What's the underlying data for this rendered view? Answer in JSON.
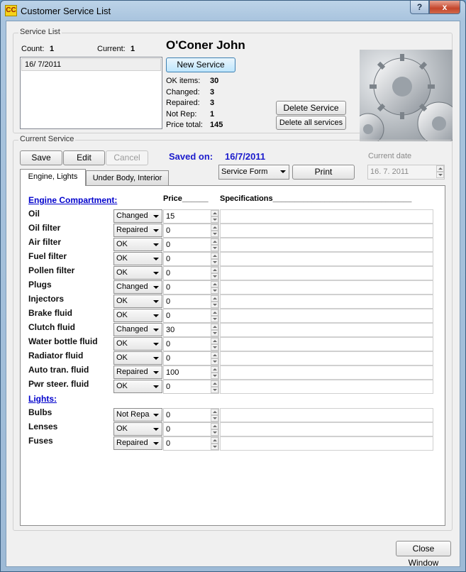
{
  "window": {
    "title": "Customer Service List",
    "icon_text": "CC",
    "help_label": "?",
    "close_label": "x"
  },
  "service_list": {
    "legend": "Service List",
    "count_label": "Count:",
    "count_value": "1",
    "current_label": "Current:",
    "current_value": "1",
    "items": [
      "16/  7/2011"
    ],
    "customer_name": "O'Coner  John",
    "new_service_label": "New Service",
    "stats": [
      {
        "label": "OK items:",
        "value": "30"
      },
      {
        "label": "Changed:",
        "value": "3"
      },
      {
        "label": "Repaired:",
        "value": "3"
      },
      {
        "label": "Not Rep:",
        "value": "1"
      },
      {
        "label": "Price total:",
        "value": "145"
      }
    ],
    "delete_service_label": "Delete Service",
    "delete_all_label": "Delete all services",
    "photo_icon": "gears-image"
  },
  "current_service": {
    "legend": "Current Service",
    "save_label": "Save",
    "edit_label": "Edit",
    "cancel_label": "Cancel",
    "saved_on_label": "Saved on:",
    "saved_on_value": "16/7/2011",
    "service_form_label": "Service Form",
    "print_label": "Print",
    "current_date_label": "Current date",
    "current_date_value": "16. 7. 2011",
    "tabs": [
      "Engine, Lights",
      "Under Body, Interior"
    ],
    "engine_header": "Engine Compartment:",
    "price_header": "Price______",
    "spec_header": "Specifications________________________________",
    "engine_items": [
      {
        "label": "Oil",
        "status": "Changed",
        "price": "15",
        "spec": ""
      },
      {
        "label": "Oil filter",
        "status": "Repaired",
        "price": "0",
        "spec": ""
      },
      {
        "label": "Air filter",
        "status": "OK",
        "price": "0",
        "spec": ""
      },
      {
        "label": "Fuel filter",
        "status": "OK",
        "price": "0",
        "spec": ""
      },
      {
        "label": "Pollen filter",
        "status": "OK",
        "price": "0",
        "spec": ""
      },
      {
        "label": "Plugs",
        "status": "Changed",
        "price": "0",
        "spec": ""
      },
      {
        "label": "Injectors",
        "status": "OK",
        "price": "0",
        "spec": ""
      },
      {
        "label": "Brake fluid",
        "status": "OK",
        "price": "0",
        "spec": ""
      },
      {
        "label": "Clutch fluid",
        "status": "Changed",
        "price": "30",
        "spec": ""
      },
      {
        "label": "Water bottle fluid",
        "status": "OK",
        "price": "0",
        "spec": ""
      },
      {
        "label": "Radiator fluid",
        "status": "OK",
        "price": "0",
        "spec": ""
      },
      {
        "label": "Auto tran. fluid",
        "status": "Repaired",
        "price": "100",
        "spec": ""
      },
      {
        "label": "Pwr steer. fluid",
        "status": "OK",
        "price": "0",
        "spec": ""
      }
    ],
    "lights_header": "Lights:",
    "light_items": [
      {
        "label": "Bulbs",
        "status": "Not Repa",
        "price": "0",
        "spec": ""
      },
      {
        "label": "Lenses",
        "status": "OK",
        "price": "0",
        "spec": ""
      },
      {
        "label": "Fuses",
        "status": "Repaired",
        "price": "0",
        "spec": ""
      }
    ]
  },
  "close_window_label": "Close Window",
  "colors": {
    "link_blue": "#0000cc",
    "saved_blue": "#1a1acc"
  }
}
